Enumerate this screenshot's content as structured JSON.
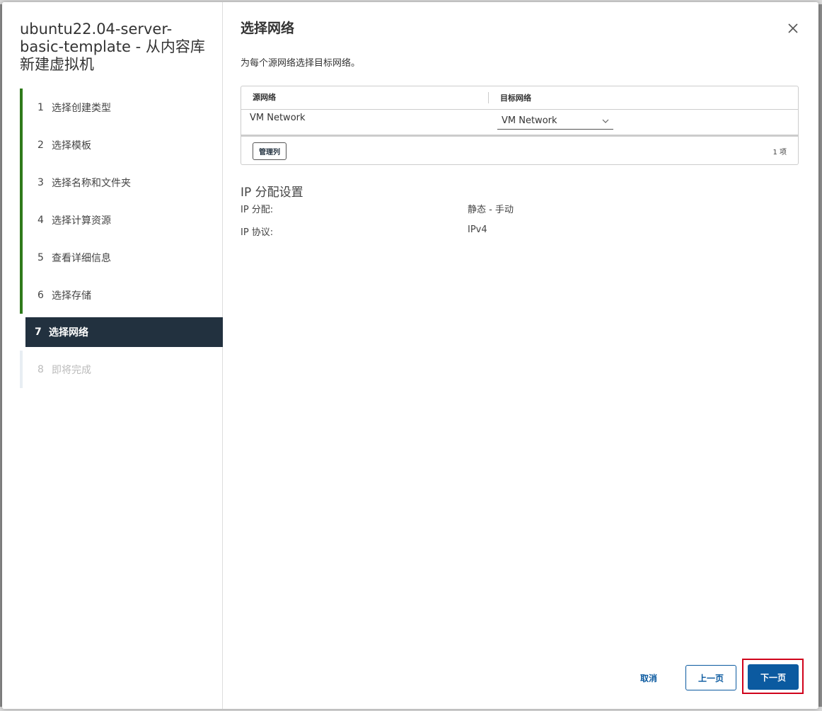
{
  "wizard": {
    "title": "ubuntu22.04-server-basic-template - 从内容库新建虚拟机",
    "steps": [
      {
        "num": "1",
        "label": "选择创建类型"
      },
      {
        "num": "2",
        "label": "选择模板"
      },
      {
        "num": "3",
        "label": "选择名称和文件夹"
      },
      {
        "num": "4",
        "label": "选择计算资源"
      },
      {
        "num": "5",
        "label": "查看详细信息"
      },
      {
        "num": "6",
        "label": "选择存储"
      },
      {
        "num": "7",
        "label": "选择网络"
      },
      {
        "num": "8",
        "label": "即将完成"
      }
    ]
  },
  "page": {
    "title": "选择网络",
    "subtitle": "为每个源网络选择目标网络。",
    "close_icon": "close-icon"
  },
  "grid": {
    "columns": [
      "源网络",
      "目标网络"
    ],
    "rows": [
      {
        "source": "VM Network",
        "target": "VM Network"
      }
    ],
    "manage_columns_label": "管理列",
    "item_count": "1 项"
  },
  "ip": {
    "section_title": "IP 分配设置",
    "allocation_label": "IP 分配:",
    "allocation_value": "静态 - 手动",
    "protocol_label": "IP 协议:",
    "protocol_value": "IPv4"
  },
  "footer": {
    "cancel_label": "取消",
    "back_label": "上一页",
    "next_label": "下一页"
  },
  "colors": {
    "accent": "#0b5aa0",
    "completed_step": "#2f7a1b",
    "active_step_bg": "#22313f",
    "highlight": "#d0021b"
  }
}
